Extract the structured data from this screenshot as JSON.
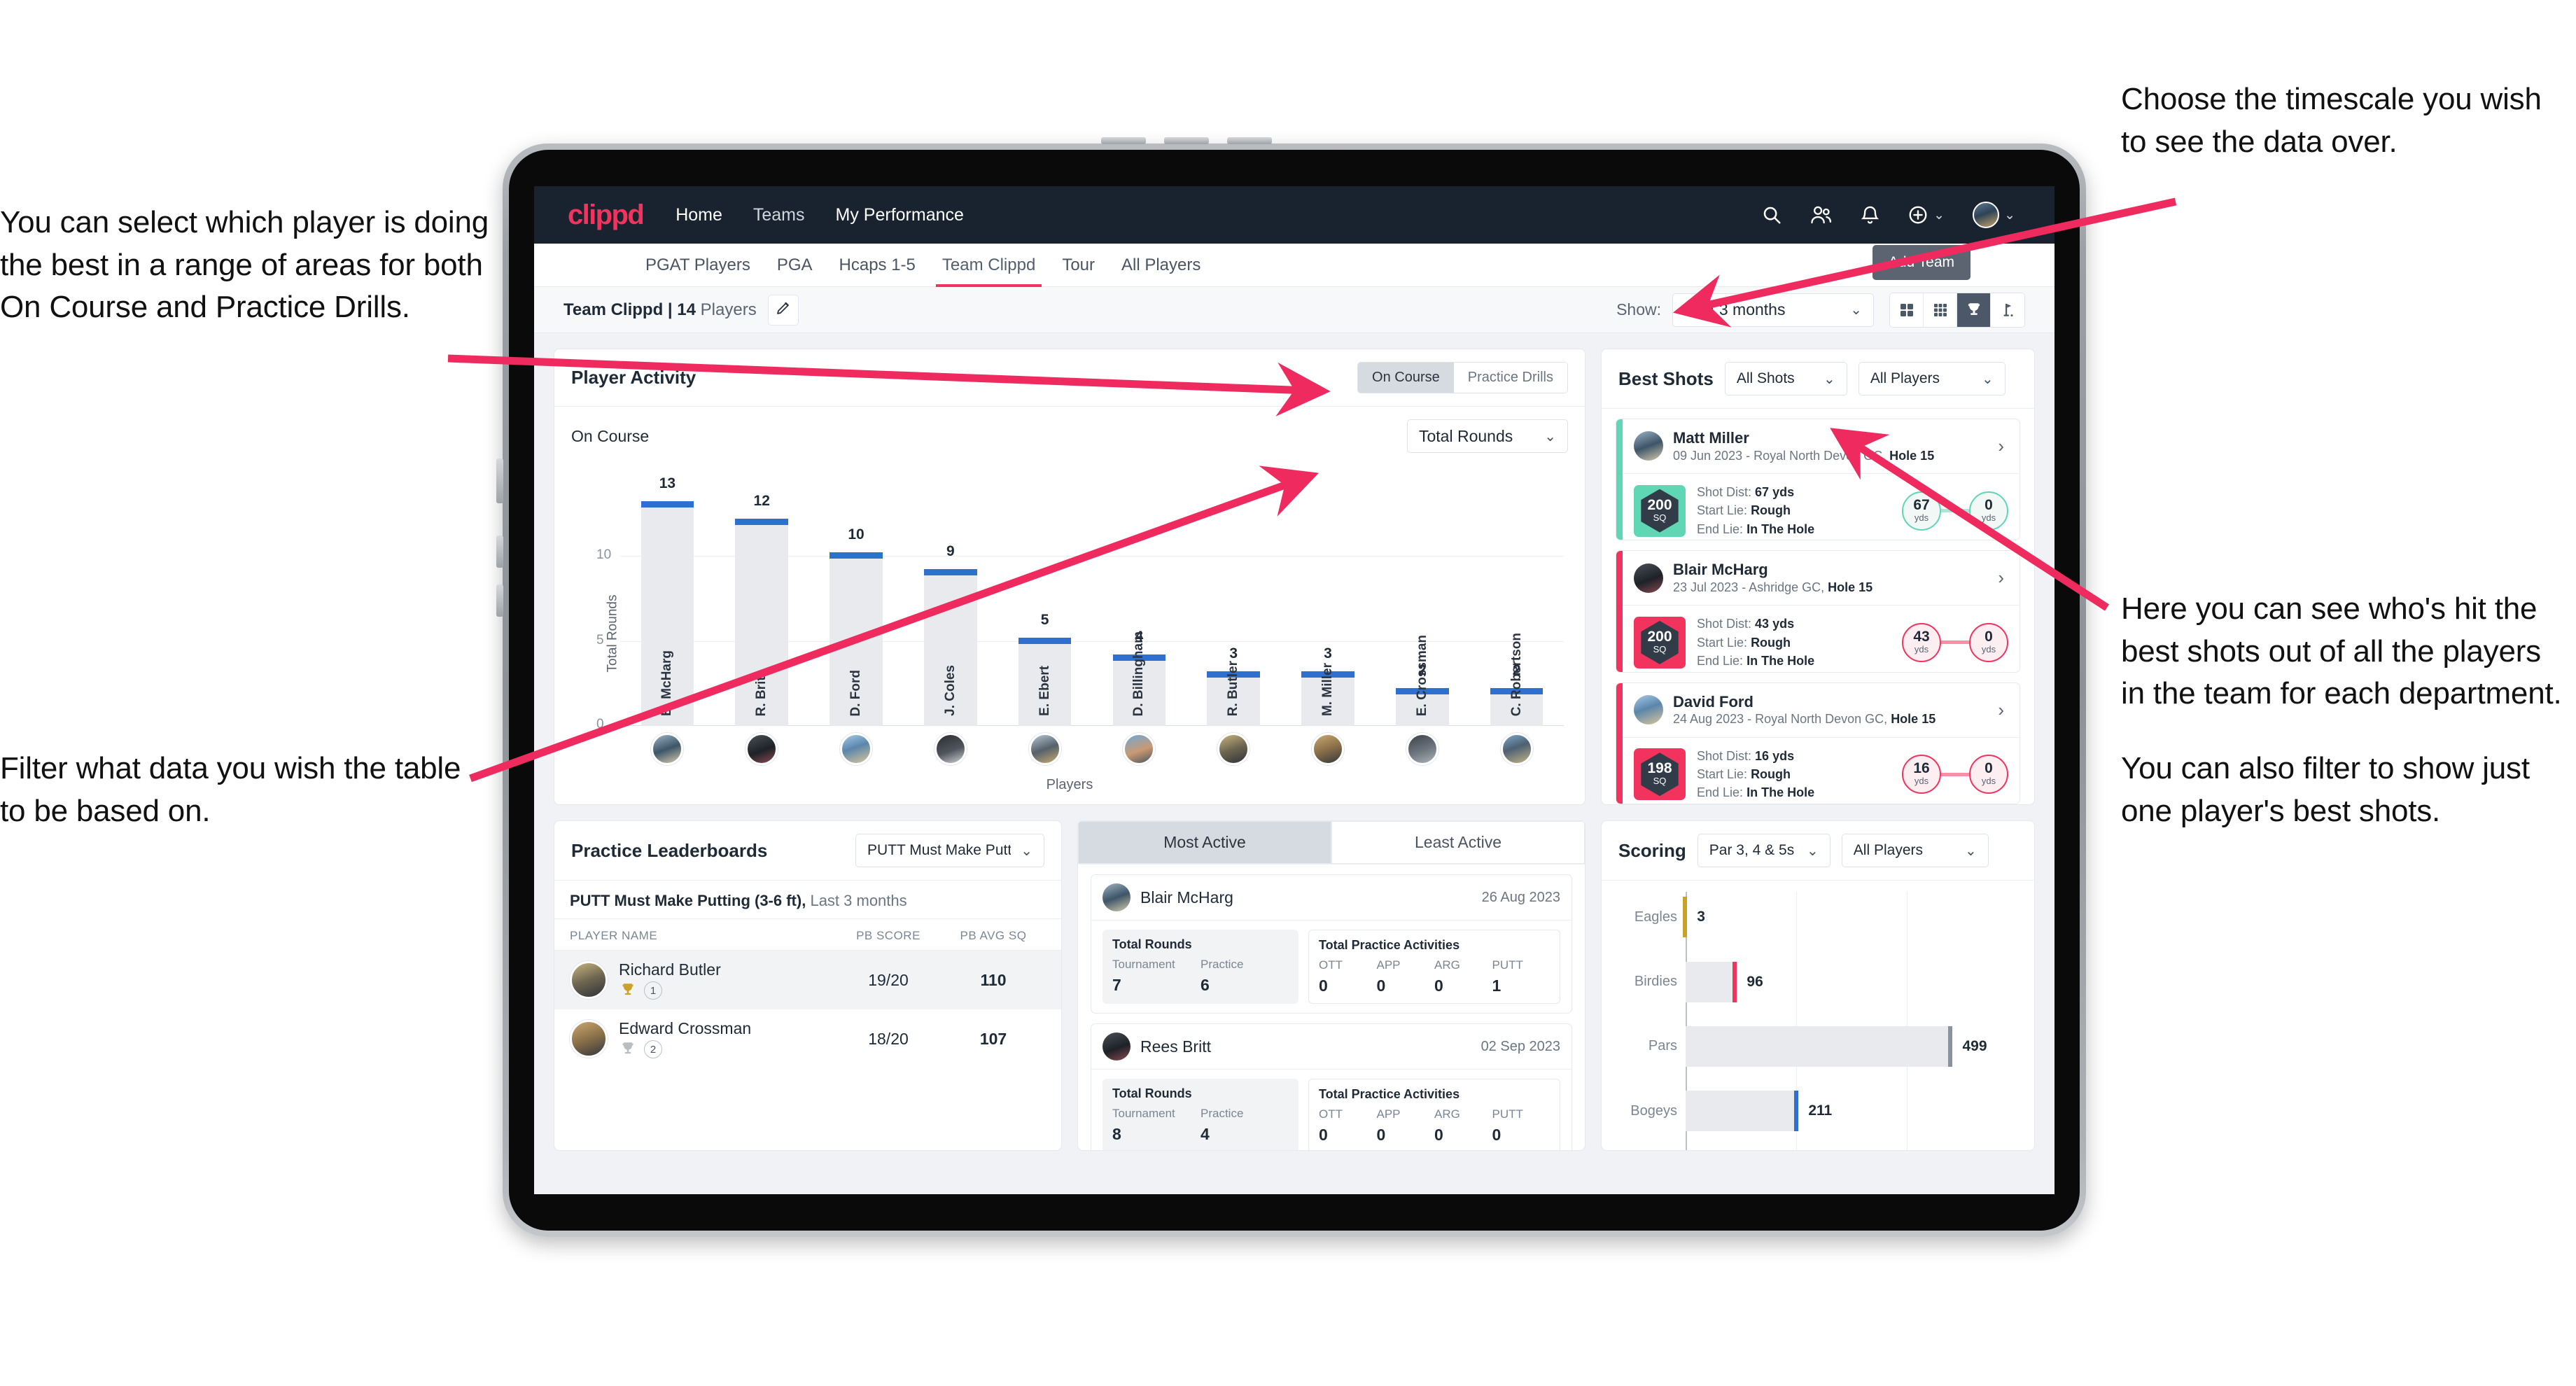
{
  "annotations": {
    "left_top": [
      "You can select which player is doing the best in a range of areas for both On Course and Practice Drills."
    ],
    "left_bottom": [
      "Filter what data you wish the table to be based on."
    ],
    "right_top": [
      "Choose the timescale you wish to see the data over."
    ],
    "right_mid": [
      "Here you can see who's hit the best shots out of all the players in the team for each department.",
      "You can also filter to show just one player's best shots."
    ],
    "arrow_color": "#ef2a5e"
  },
  "topnav": {
    "brand": "clippd",
    "links": [
      {
        "label": "Home",
        "active": true
      },
      {
        "label": "Teams",
        "active": false
      },
      {
        "label": "My Performance",
        "active": true
      }
    ],
    "icons": [
      "search-icon",
      "people-icon",
      "bell-icon",
      "plus-circle-icon",
      "avatar-icon"
    ]
  },
  "tabs": [
    {
      "label": "PGAT Players",
      "active": false
    },
    {
      "label": "PGA",
      "active": false
    },
    {
      "label": "Hcaps 1-5",
      "active": false
    },
    {
      "label": "Team Clippd",
      "active": true
    },
    {
      "label": "Tour",
      "active": false
    },
    {
      "label": "All Players",
      "active": false
    }
  ],
  "add_team_button": "Add Team",
  "subbar": {
    "team_name": "Team Clippd",
    "separator": "|",
    "player_count": "14",
    "players_word": "Players",
    "edit_icon": "pencil-icon",
    "show_label": "Show:",
    "timescale_value": "Last 3 months",
    "view_buttons": [
      "grid-2x2-icon",
      "grid-3x3-icon",
      "trophy-icon",
      "golf-flag-icon"
    ],
    "active_view": 2
  },
  "player_activity": {
    "title": "Player Activity",
    "segments": [
      {
        "label": "On Course",
        "active": true
      },
      {
        "label": "Practice Drills",
        "active": false
      }
    ],
    "sub_label": "On Course",
    "metric_select": "Total Rounds"
  },
  "chart_data": [
    {
      "type": "bar",
      "title": "Player Activity",
      "xlabel": "Players",
      "ylabel": "Total Rounds",
      "ylim": [
        0,
        14
      ],
      "yticks": [
        0,
        5,
        10
      ],
      "grid": true,
      "bar_color": "#e8eaee",
      "cap_color": "#2f6fd0",
      "categories": [
        "B. McHarg",
        "R. Britt",
        "D. Ford",
        "J. Coles",
        "E. Ebert",
        "D. Billingham",
        "R. Butler",
        "M. Miller",
        "E. Crossman",
        "C. Robertson"
      ],
      "values": [
        13,
        12,
        10,
        9,
        5,
        4,
        3,
        3,
        2,
        2
      ]
    },
    {
      "type": "bar",
      "orientation": "horizontal",
      "title": "Scoring",
      "xlabel": "",
      "ylabel": "",
      "categories": [
        "Eagles",
        "Birdies",
        "Pars",
        "Bogeys"
      ],
      "values": [
        3,
        96,
        499,
        211
      ],
      "xlim": [
        0,
        620
      ],
      "bar_color": "#e8eaee",
      "cap_colors": [
        "#c9a227",
        "#f2335d",
        "#8a939d",
        "#2f6fd0"
      ]
    }
  ],
  "best_shots": {
    "title": "Best Shots",
    "shot_filter": "All Shots",
    "player_filter": "All Players",
    "labels": {
      "shot_dist": "Shot Dist:",
      "start_lie": "Start Lie:",
      "end_lie": "End Lie:",
      "yds": "yds",
      "sq": "SQ"
    },
    "items": [
      {
        "name": "Matt Miller",
        "meta_date": "09 Jun 2023 - Royal North Devon GC,",
        "meta_hole": "Hole 15",
        "sq": "200",
        "shot_dist": "67 yds",
        "start_lie": "Rough",
        "end_lie": "In The Hole",
        "from_val": "67",
        "to_val": "0",
        "accent": "#5fd6b4",
        "tile_bg": "#5fd6b4",
        "circle_bg": "#f2f8f6"
      },
      {
        "name": "Blair McHarg",
        "meta_date": "23 Jul 2023 - Ashridge GC,",
        "meta_hole": "Hole 15",
        "sq": "200",
        "shot_dist": "43 yds",
        "start_lie": "Rough",
        "end_lie": "In The Hole",
        "from_val": "43",
        "to_val": "0",
        "accent": "#f2335d",
        "tile_bg": "#f2335d",
        "circle_bg": "#fdeef2"
      },
      {
        "name": "David Ford",
        "meta_date": "24 Aug 2023 - Royal North Devon GC,",
        "meta_hole": "Hole 15",
        "sq": "198",
        "shot_dist": "16 yds",
        "start_lie": "Rough",
        "end_lie": "In The Hole",
        "from_val": "16",
        "to_val": "0",
        "accent": "#f2335d",
        "tile_bg": "#f2335d",
        "circle_bg": "#fdeef2"
      }
    ]
  },
  "practice_leaderboards": {
    "title": "Practice Leaderboards",
    "drill_select": "PUTT Must Make Putting ...",
    "subtitle_bold": "PUTT Must Make Putting (3-6 ft),",
    "subtitle_light": "Last 3 months",
    "columns": [
      "PLAYER NAME",
      "PB SCORE",
      "PB AVG SQ"
    ],
    "rows": [
      {
        "name": "Richard Butler",
        "rank": "1",
        "trophy": "gold",
        "pb_score": "19/20",
        "pb_avg_sq": "110",
        "highlight": true
      },
      {
        "name": "Edward Crossman",
        "rank": "2",
        "trophy": "silver",
        "pb_score": "18/20",
        "pb_avg_sq": "107",
        "highlight": false
      }
    ]
  },
  "activity": {
    "tabs": [
      {
        "label": "Most Active",
        "active": true
      },
      {
        "label": "Least Active",
        "active": false
      }
    ],
    "labels": {
      "total_rounds": "Total Rounds",
      "tournament": "Tournament",
      "practice": "Practice",
      "total_practice": "Total Practice Activities",
      "ott": "OTT",
      "app": "APP",
      "arg": "ARG",
      "putt": "PUTT"
    },
    "items": [
      {
        "name": "Blair McHarg",
        "date": "26 Aug 2023",
        "tournament": "7",
        "practice": "6",
        "ott": "0",
        "app": "0",
        "arg": "0",
        "putt": "1"
      },
      {
        "name": "Rees Britt",
        "date": "02 Sep 2023",
        "tournament": "8",
        "practice": "4",
        "ott": "0",
        "app": "0",
        "arg": "0",
        "putt": "0"
      }
    ]
  },
  "scoring": {
    "title": "Scoring",
    "par_select": "Par 3, 4 & 5s",
    "player_select": "All Players"
  }
}
